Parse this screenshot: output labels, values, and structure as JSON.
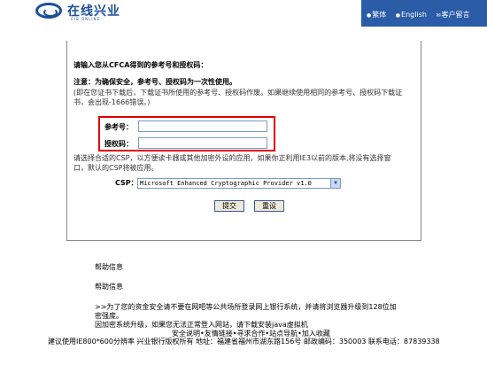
{
  "header": {
    "logo_text": "在线兴业",
    "logo_sub": "CIB ONLINE",
    "nav": [
      {
        "label": "繁体"
      },
      {
        "label": "English"
      },
      {
        "label": "客户留言"
      }
    ]
  },
  "form": {
    "prompt": "请输入您从CFCA得到的参考号和授权码：",
    "notice": "注意：为确保安全，参考号、授权码为一次性使用。",
    "notice_detail_1": "(即在您证书下载后，下载证书所使用的参考号、授权码作废。如果继续使用相同的参考号、授权码下载证",
    "notice_detail_2": "书，会出现-1666错误。)",
    "ref_label": "参考号：",
    "ref_value": "",
    "auth_label": "授权码：",
    "auth_value": "",
    "csp_hint_1": "请选择合适的CSP，以方便读卡器或其他加密外设的应用，如果你正利用IE3以前的版本,将没有选择窗",
    "csp_hint_2": "口，默认的CSP将被应用。",
    "csp_label": "CSP：",
    "csp_selected": "Microsoft Enhanced Cryptographic Provider v1.0",
    "submit_label": "提交",
    "reset_label": "重设"
  },
  "help": {
    "title_1": "帮助信息",
    "title_2": "帮助信息",
    "line_1": ">>为了您的资金安全请不要在网吧等公共场所登录网上银行系统，并请将浏览器升级到128位加",
    "line_2": "密强度。",
    "line_3": "因加密系统升级，如果您无法正常登入网站，请下载安装java虚拟机",
    "line_4": "安全说明•友情链接•寻求合作•站点导航•加入收藏"
  },
  "footer": {
    "text": "建议使用IE800*600分辨率  兴业银行版权所有  地址：福建省福州市湖东路156号   邮政编码：350003   联系电话：87839338"
  }
}
